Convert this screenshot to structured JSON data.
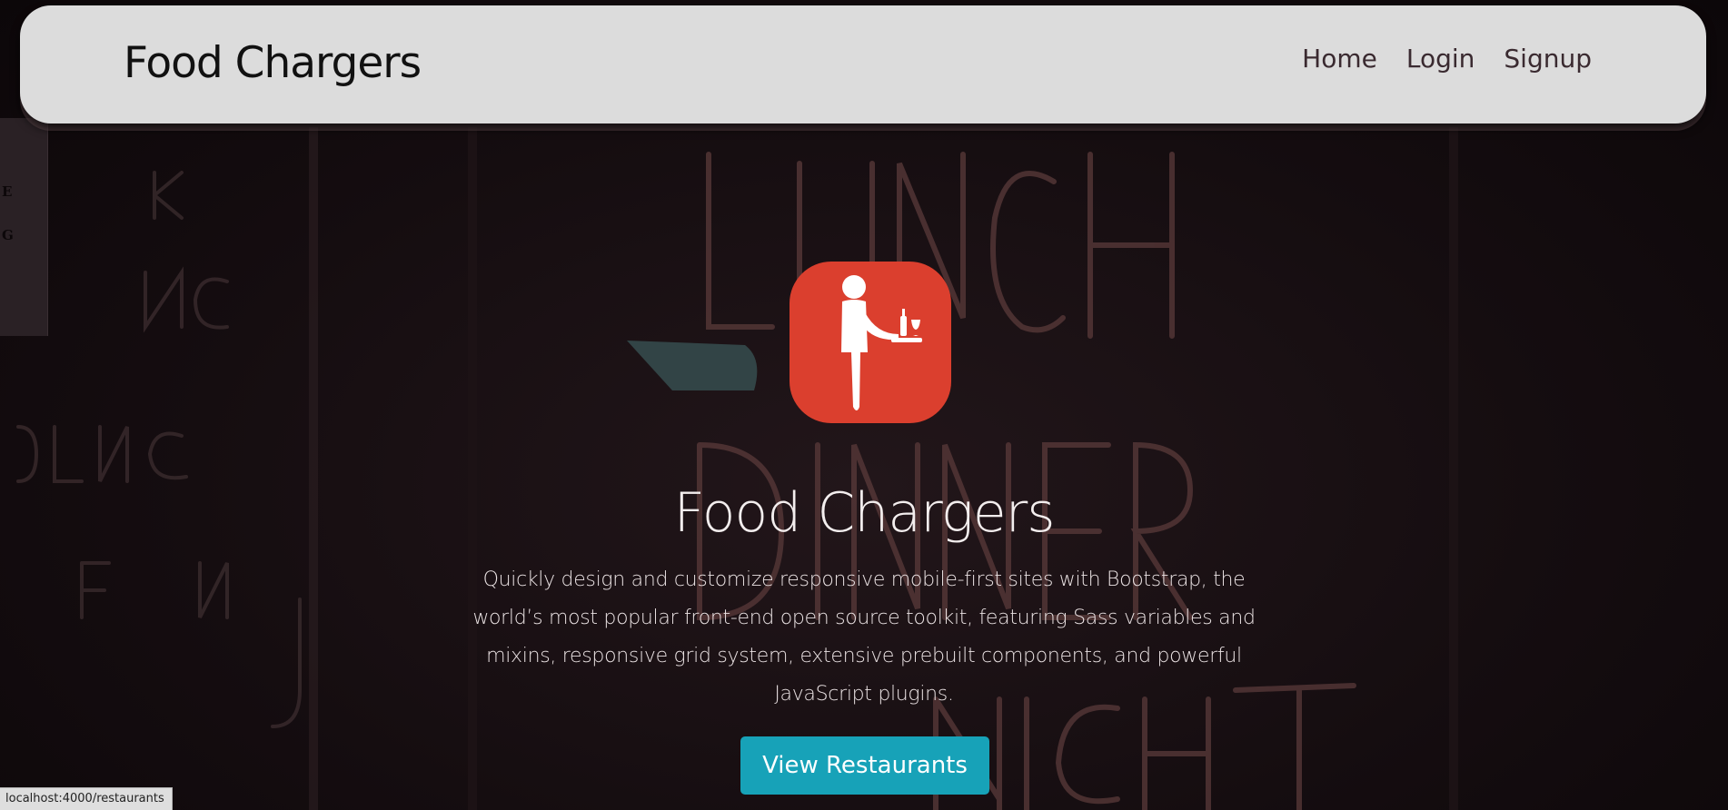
{
  "navbar": {
    "brand": "Food Chargers",
    "links": [
      {
        "label": "Home"
      },
      {
        "label": "Login"
      },
      {
        "label": "Signup"
      }
    ]
  },
  "hero": {
    "logo_icon": "waiter-with-tray-icon",
    "title": "Food Chargers",
    "description": "Quickly design and customize responsive mobile-first sites with Bootstrap, the world’s most popular front-end open source toolkit, featuring Sass variables and mixins, responsive grid system, extensive prebuilt components, and powerful JavaScript plugins.",
    "cta_label": "View Restaurants"
  },
  "background": {
    "left_panel_letters": [
      "E",
      "G"
    ]
  },
  "status_bar": {
    "url": "localhost:4000/restaurants"
  },
  "colors": {
    "navbar_bg": "#dcdcdc",
    "logo_bg": "#db3f2e",
    "cta_bg": "#17a2b8",
    "page_bg": "#140d10"
  }
}
